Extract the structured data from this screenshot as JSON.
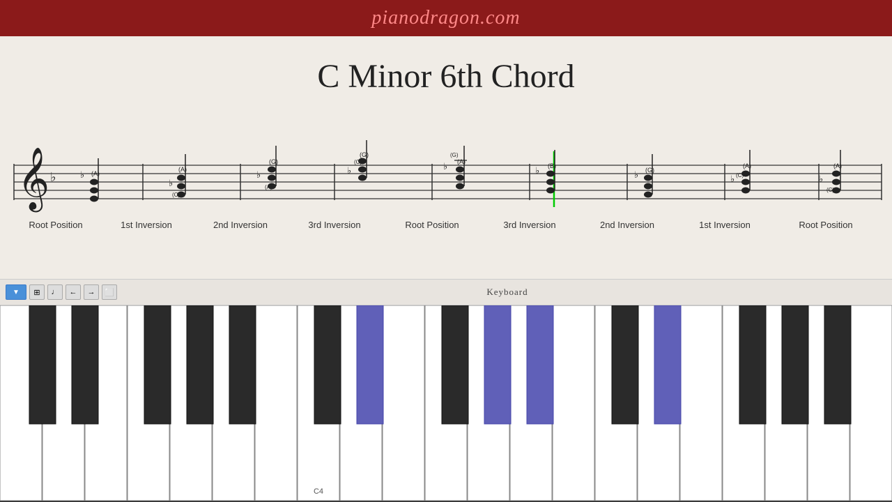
{
  "header": {
    "site": "pianodragon.com"
  },
  "chord": {
    "title": "C Minor 6th Chord"
  },
  "staff": {
    "labels": [
      "Root Position",
      "1st Inversion",
      "2nd Inversion",
      "3rd Inversion",
      "Root Position",
      "3rd Inversion",
      "2nd Inversion",
      "1st Inversion",
      "Root Position"
    ]
  },
  "keyboard": {
    "label": "Keyboard",
    "note_label": "C4"
  },
  "toolbar": {
    "dropdown_symbol": "▼"
  }
}
